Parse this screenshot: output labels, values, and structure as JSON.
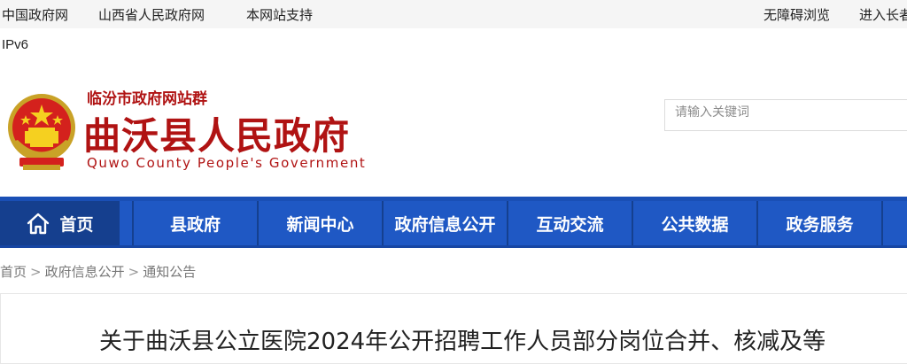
{
  "topbar": {
    "links": [
      "中国政府网",
      "山西省人民政府网",
      "本网站支持"
    ],
    "accessibility": "无障碍浏览",
    "elder_mode": "进入长者"
  },
  "ipv6_label": "IPv6",
  "header": {
    "site_group": "临汾市政府网站群",
    "title": "曲沃县人民政府",
    "subtitle": "Quwo County People's Government",
    "emblem_icon": "national-emblem-icon"
  },
  "search": {
    "placeholder": "请输入关键词"
  },
  "nav": {
    "items": [
      "首页",
      "县政府",
      "新闻中心",
      "政府信息公开",
      "互动交流",
      "公共数据",
      "政务服务"
    ]
  },
  "breadcrumb": {
    "items": [
      "首页",
      "政府信息公开",
      "通知公告"
    ],
    "separator": ">"
  },
  "article": {
    "title": "关于曲沃县公立医院2024年公开招聘工作人员部分岗位合并、核减及等"
  },
  "colors": {
    "brand_red": "#b01313",
    "nav_blue": "#1f58c4",
    "nav_home_blue": "#153f8e"
  }
}
